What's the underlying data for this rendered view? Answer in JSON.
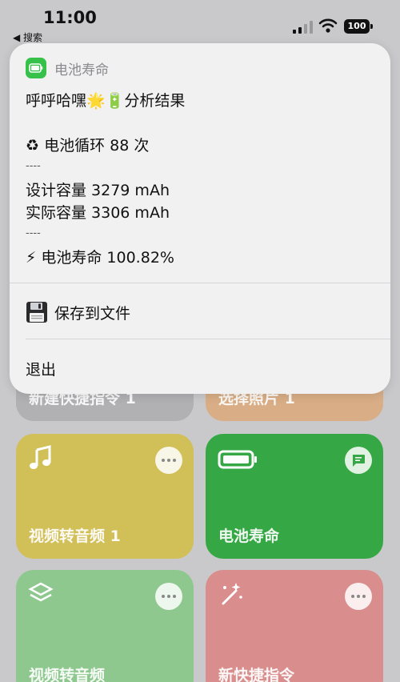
{
  "status_bar": {
    "time": "11:00",
    "back_label": "◀ 搜索",
    "battery_level": "100"
  },
  "popup": {
    "app_name": "电池寿命",
    "title": "呼呼哈嘿🌟🔋分析结果",
    "cycle_line": "♻ 电池循环 88 次",
    "separator": "----",
    "design_capacity_line": "设计容量 3279 mAh",
    "actual_capacity_line": "实际容量 3306 mAh",
    "battery_life_line": "⚡ 电池寿命 100.82%",
    "save_label": "保存到文件",
    "exit_label": "退出"
  },
  "shortcuts": [
    {
      "label": "新建快捷指令 1",
      "color": "#b1b1b4"
    },
    {
      "label": "选择照片 1",
      "color": "#d9ae86"
    },
    {
      "label": "视频转音频 1",
      "color": "#d1bf58",
      "icon": "music-note-icon"
    },
    {
      "label": "电池寿命",
      "color": "#35a845",
      "icon": "battery-icon"
    },
    {
      "label": "视频转音频",
      "color": "#8ec88f",
      "icon": "layers-icon"
    },
    {
      "label": "新快捷指令",
      "color": "#d98d8d",
      "icon": "magic-wand-icon"
    }
  ],
  "colors": {
    "accent_green": "#35c14a",
    "card_background": "#f1f1f2"
  }
}
